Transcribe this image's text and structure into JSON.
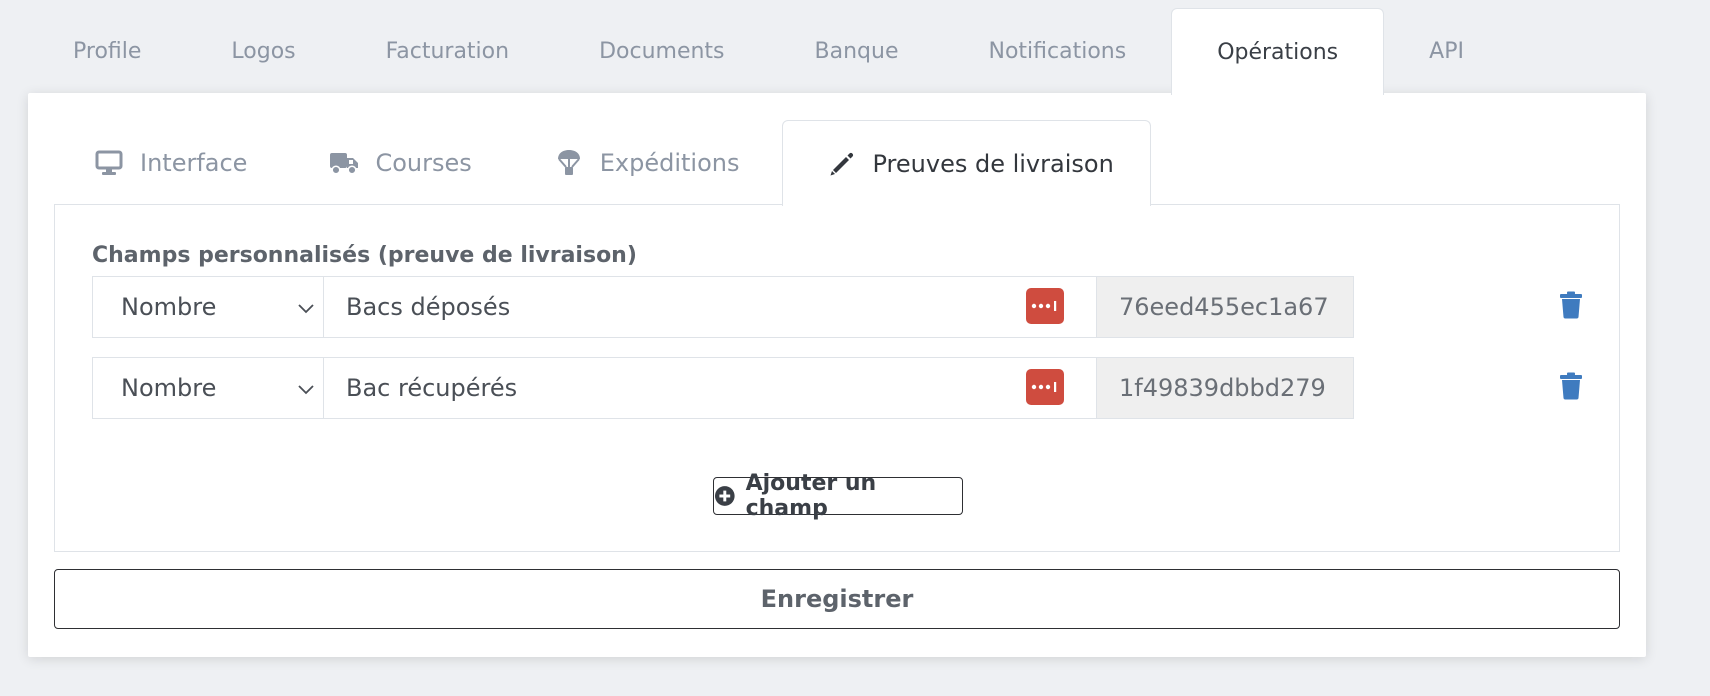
{
  "top_tabs": [
    {
      "label": "Profile",
      "active": false
    },
    {
      "label": "Logos",
      "active": false
    },
    {
      "label": "Facturation",
      "active": false
    },
    {
      "label": "Documents",
      "active": false
    },
    {
      "label": "Banque",
      "active": false
    },
    {
      "label": "Notifications",
      "active": false
    },
    {
      "label": "Opérations",
      "active": true
    },
    {
      "label": "API",
      "active": false
    }
  ],
  "sub_tabs": [
    {
      "label": "Interface",
      "icon": "monitor-icon",
      "active": false
    },
    {
      "label": "Courses",
      "icon": "truck-icon",
      "active": false
    },
    {
      "label": "Expéditions",
      "icon": "parachute-box-icon",
      "active": false
    },
    {
      "label": "Preuves de livraison",
      "icon": "pencil-icon",
      "active": true
    }
  ],
  "section": {
    "title": "Champs personnalisés (preuve de livraison)"
  },
  "fields": [
    {
      "type": "Nombre",
      "label": "Bacs déposés",
      "key": "76eed455ec1a67"
    },
    {
      "type": "Nombre",
      "label": "Bac récupérés",
      "key": "1f49839dbbd279"
    }
  ],
  "actions": {
    "add_field_label": "Ajouter un champ",
    "save_label": "Enregistrer"
  },
  "colors": {
    "password_badge": "#cf4c3f",
    "delete_icon": "#3f7bbf",
    "tab_inactive": "#8c95a3",
    "tab_active": "#33373d"
  }
}
